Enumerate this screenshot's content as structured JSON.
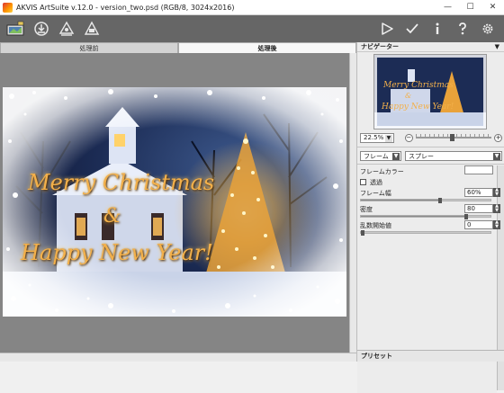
{
  "window": {
    "title": "AKVIS ArtSuite v.12.0 - version_two.psd (RGB/8, 3024x2016)",
    "minimize": "—",
    "maximize": "☐",
    "close": "✕"
  },
  "toolbar": {
    "left_icons": [
      "open-image-icon",
      "save-image-icon",
      "share-icon",
      "print-icon"
    ],
    "right_icons": [
      "run-icon",
      "apply-icon",
      "info-icon",
      "help-icon",
      "settings-icon"
    ]
  },
  "tabs": [
    {
      "label": "処理前",
      "active": false
    },
    {
      "label": "処理後",
      "active": true
    }
  ],
  "image": {
    "greeting_line1": "Merry Christmas",
    "greeting_line2": "&",
    "greeting_line3": "Happy New Year!"
  },
  "navigator": {
    "title": "ナビゲーター",
    "zoom": "22.5%",
    "zoom_fraction": 0.45
  },
  "settings": {
    "category": "フレーム",
    "frame_type": "スプレー",
    "frame_color_label": "フレームカラー",
    "frame_color": "#ffffff",
    "transparent_label": "透過",
    "transparent_checked": false,
    "frame_width_label": "フレーム幅",
    "frame_width": "60%",
    "frame_width_fraction": 0.6,
    "density_label": "密度",
    "density": "80",
    "density_fraction": 0.8,
    "seed_label": "乱数開始値",
    "seed": "0",
    "seed_fraction": 0
  },
  "presets": {
    "title": "プリセット"
  },
  "colors": {
    "toolbar_bg": "#666666",
    "canvas_bg": "#858585",
    "text_accent": "#f3b04a"
  }
}
